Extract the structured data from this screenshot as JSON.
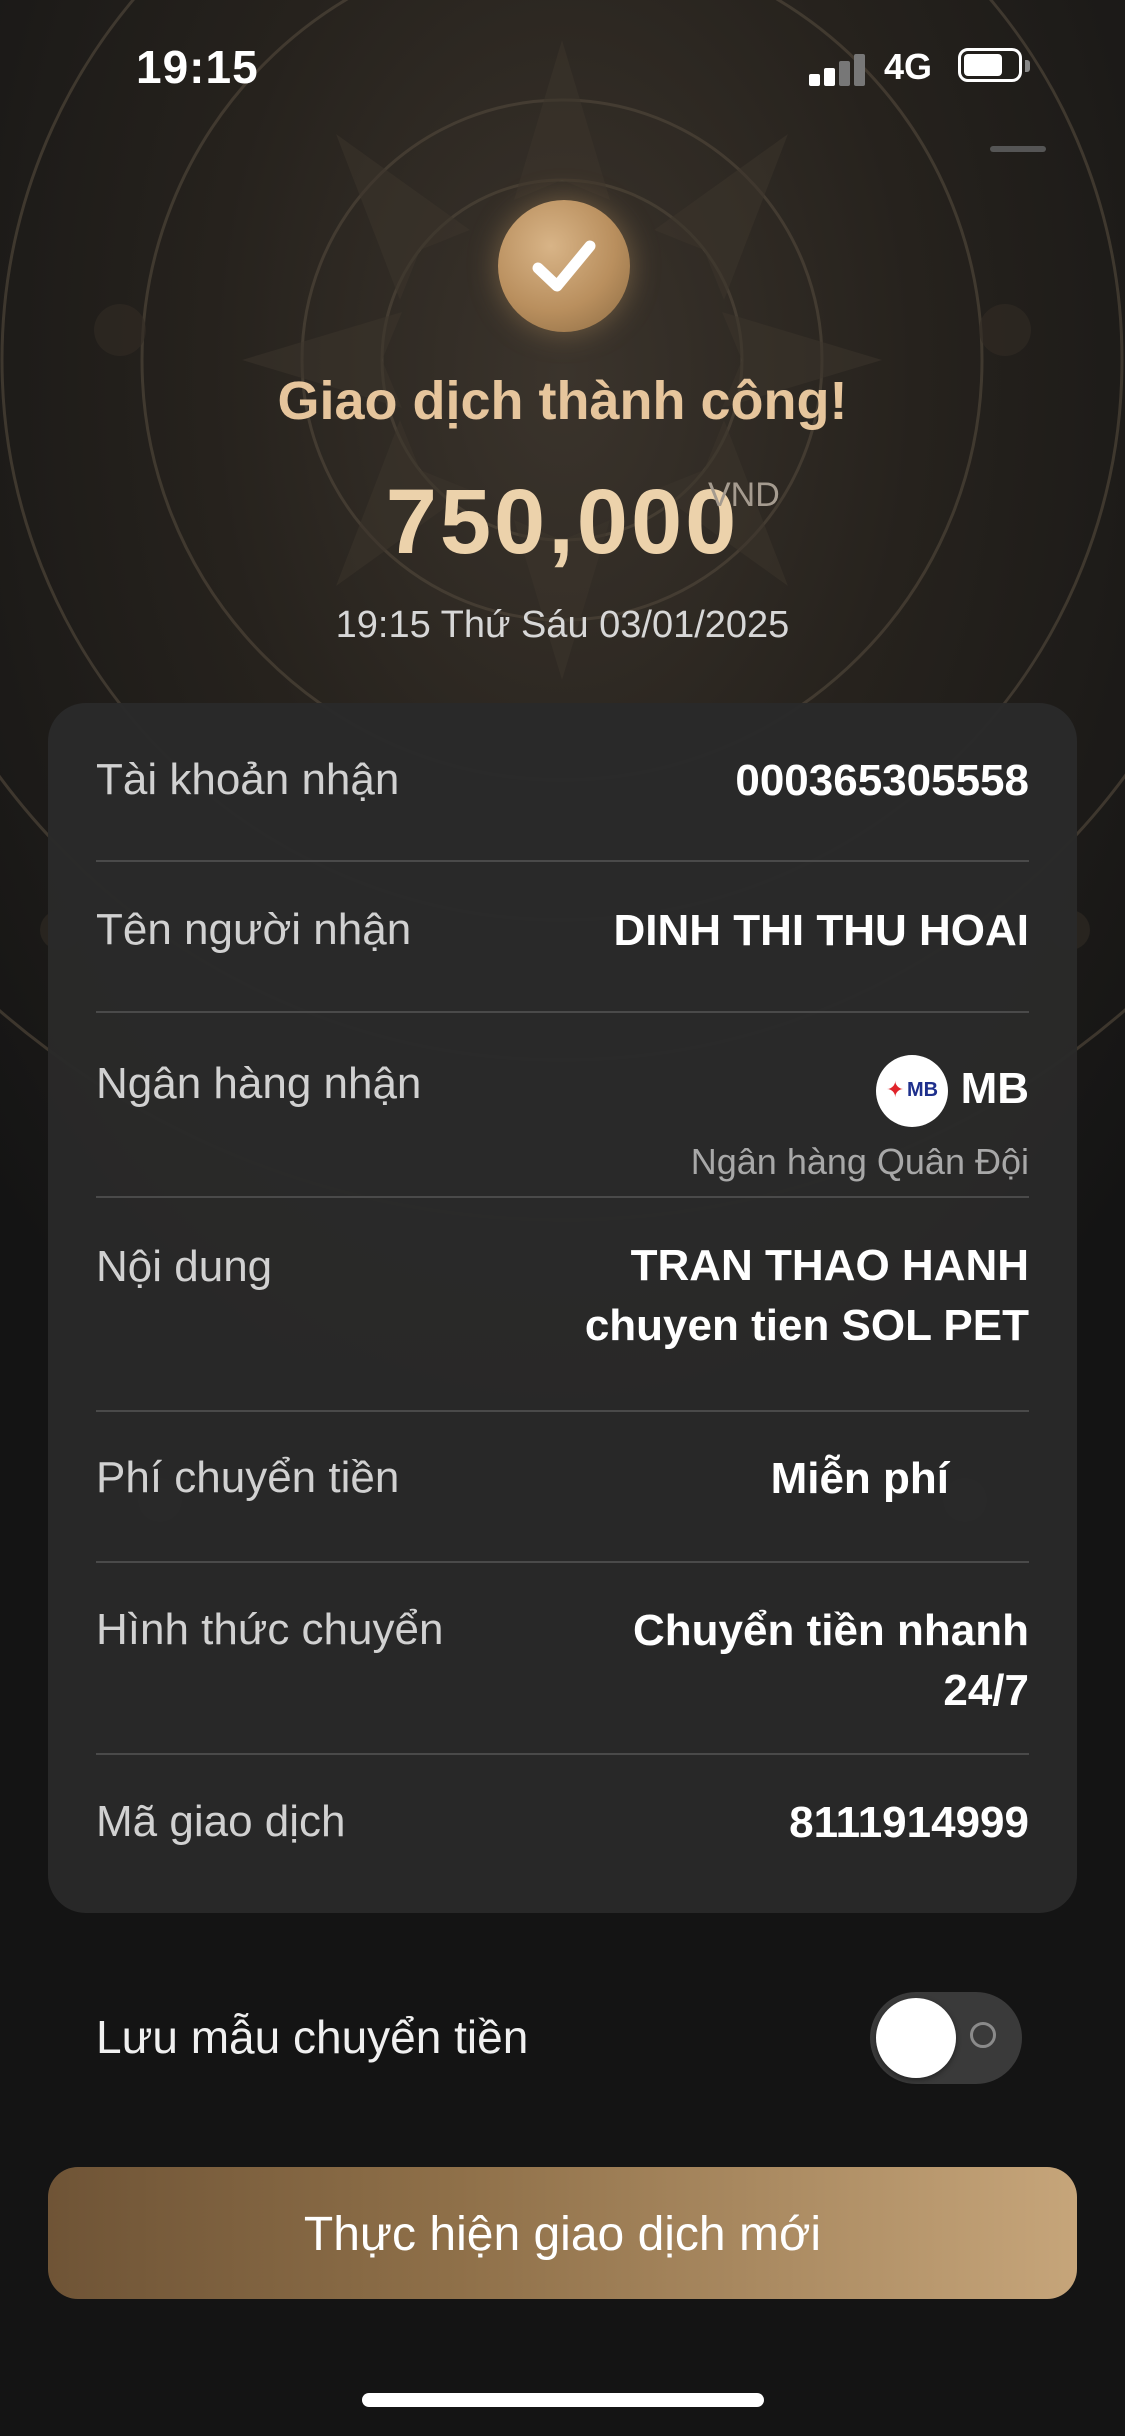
{
  "status_bar": {
    "time": "19:15",
    "network": "4G",
    "battery_level": 0.6
  },
  "result": {
    "title": "Giao dịch thành công!",
    "amount": "750,000",
    "currency": "VND",
    "datetime": "19:15 Thứ Sáu 03/01/2025"
  },
  "details": {
    "account": {
      "label": "Tài khoản nhận",
      "value": "000365305558"
    },
    "recipient": {
      "label": "Tên người nhận",
      "value": "DINH THI THU HOAI"
    },
    "bank": {
      "label": "Ngân hàng nhận",
      "code": "MB",
      "logo_text": "MB",
      "full_name": "Ngân hàng Quân Đội"
    },
    "content": {
      "label": "Nội dung",
      "line1": "TRAN THAO HANH",
      "line2": "chuyen tien SOL PET"
    },
    "fee": {
      "label": "Phí chuyển tiền",
      "value": "Miễn phí"
    },
    "method": {
      "label": "Hình thức chuyển",
      "line1": "Chuyển tiền nhanh",
      "line2": "24/7"
    },
    "transaction_id": {
      "label": "Mã giao dịch",
      "value": "8111914999"
    }
  },
  "save_template": {
    "label": "Lưu mẫu chuyển tiền",
    "enabled": false
  },
  "new_transaction_button": "Thực hiện giao dịch mới",
  "colors": {
    "background": "#141414",
    "card": "#2a2a2a",
    "accent_gold": "#e6c59c",
    "button_gradient_start": "#6f5436",
    "button_gradient_end": "#c6a57a"
  },
  "icons": [
    "signal-icon",
    "battery-icon",
    "check-icon",
    "mb-bank-logo",
    "toggle-off-icon"
  ]
}
